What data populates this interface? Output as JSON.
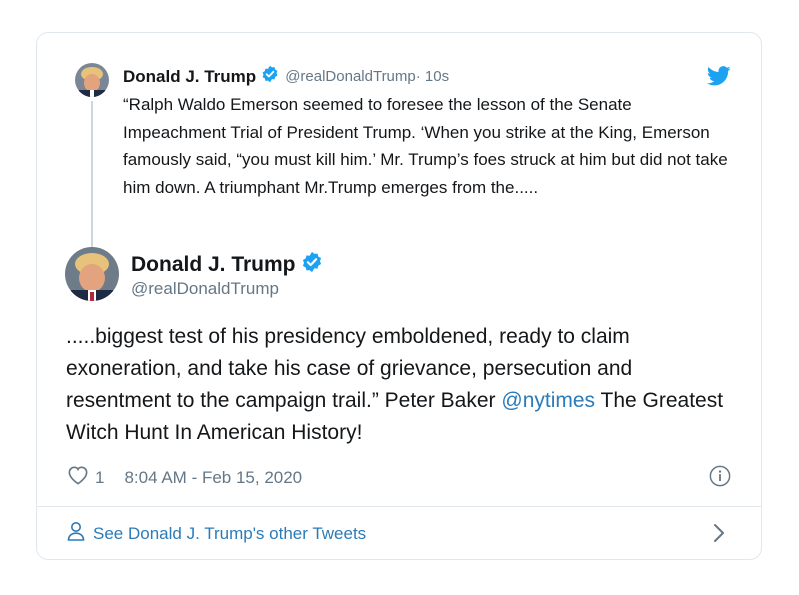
{
  "parent_tweet": {
    "author_name": "Donald J. Trump",
    "handle": "@realDonaldTrump",
    "time": " · 10s",
    "text": "“Ralph Waldo Emerson seemed to foresee the lesson of the Senate Impeachment Trial of President Trump. ‘When you strike at the King, Emerson famously said, “you must kill him.’ Mr. Trump’s foes struck at him but did not take him down. A triumphant Mr.Trump emerges from the....."
  },
  "main_tweet": {
    "author_name": "Donald J. Trump",
    "handle": "@realDonaldTrump",
    "text_part1": ".....biggest test of his presidency emboldened, ready to claim exoneration, and take his case of grievance, persecution and resentment to the campaign trail.” Peter Baker ",
    "mention": "@nytimes",
    "text_part2": " The Greatest Witch Hunt In American History!",
    "likes": "1",
    "timestamp": "8:04 AM - Feb 15, 2020"
  },
  "footer": {
    "link_text": "See Donald J. Trump's other Tweets"
  },
  "icons": {
    "verified": "verified-badge-icon",
    "bird": "twitter-bird-icon",
    "heart": "heart-icon",
    "info": "info-icon",
    "person": "person-icon",
    "chevron": "chevron-right-icon"
  },
  "colors": {
    "twitter_blue": "#1da1f2",
    "link_blue": "#2b7bb9",
    "secondary_text": "#657786",
    "border": "#e1e8ed"
  }
}
